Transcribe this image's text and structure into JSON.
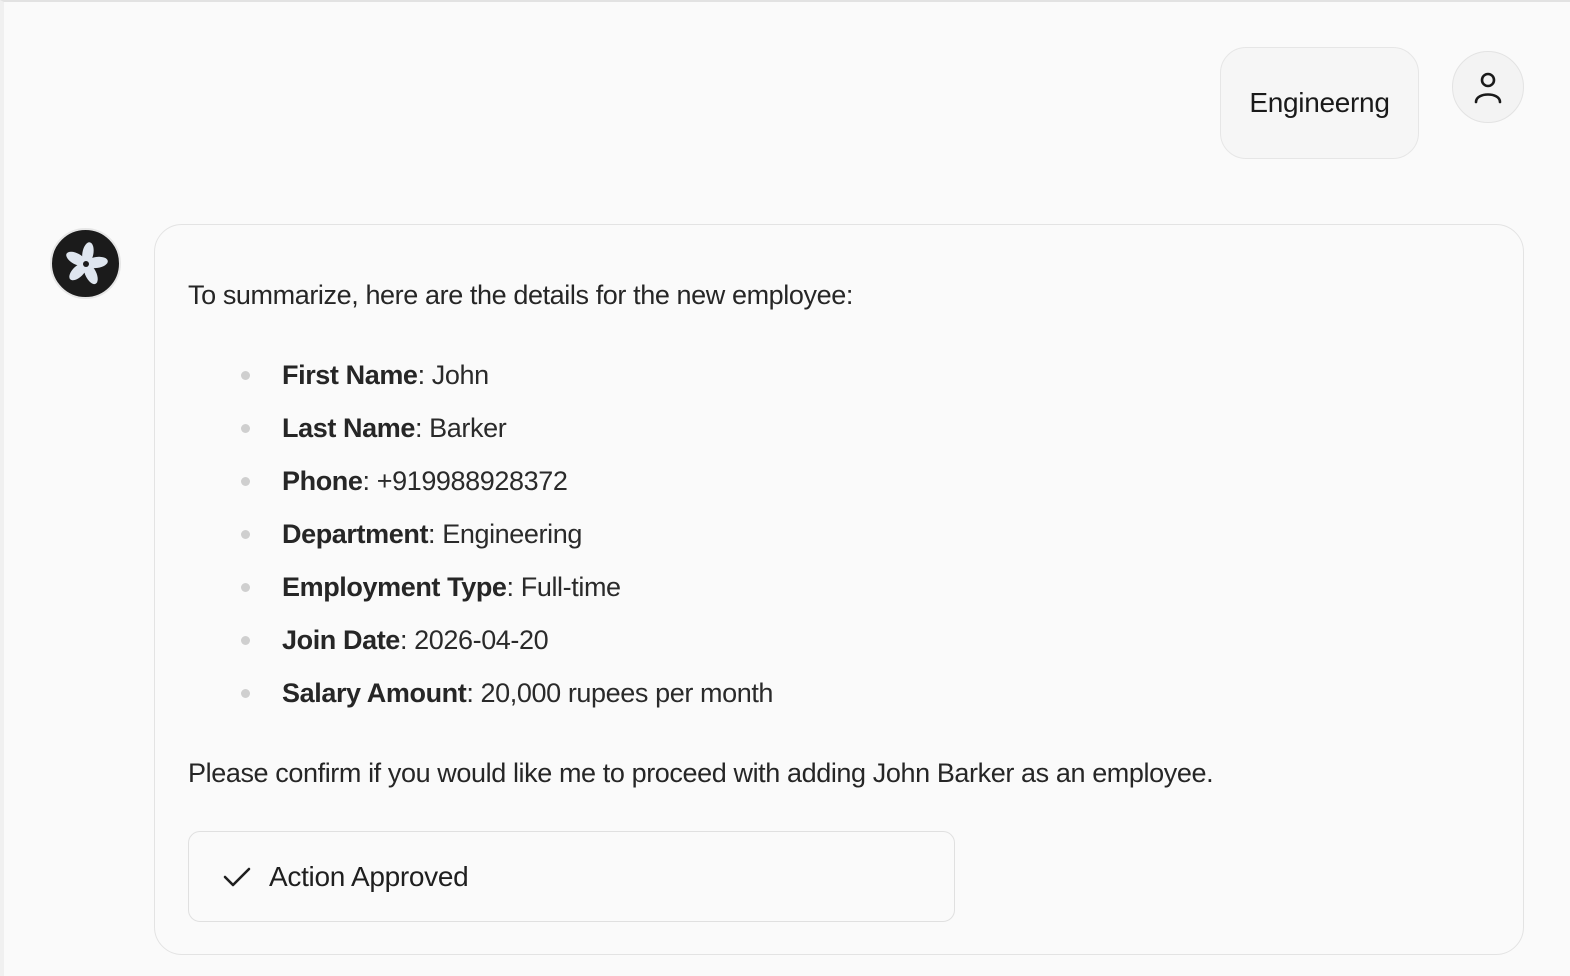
{
  "user_message": {
    "text": "Engineerng",
    "avatar_icon": "user-icon"
  },
  "assistant_message": {
    "avatar_icon": "asterisk-flower-logo",
    "intro": "To summarize, here are the details for the new employee:",
    "details": [
      {
        "label": "First Name",
        "value": ": John"
      },
      {
        "label": "Last Name",
        "value": ": Barker"
      },
      {
        "label": "Phone",
        "value": ": +919988928372"
      },
      {
        "label": "Department",
        "value": ": Engineering"
      },
      {
        "label": "Employment Type",
        "value": ": Full-time"
      },
      {
        "label": "Join Date",
        "value": ": 2026-04-20"
      },
      {
        "label": "Salary Amount",
        "value": ": 20,000 rupees per month"
      }
    ],
    "outro": "Please confirm if you would like me to proceed with adding John Barker as an employee.",
    "approval": {
      "icon": "check-icon",
      "label": "Action Approved"
    }
  }
}
